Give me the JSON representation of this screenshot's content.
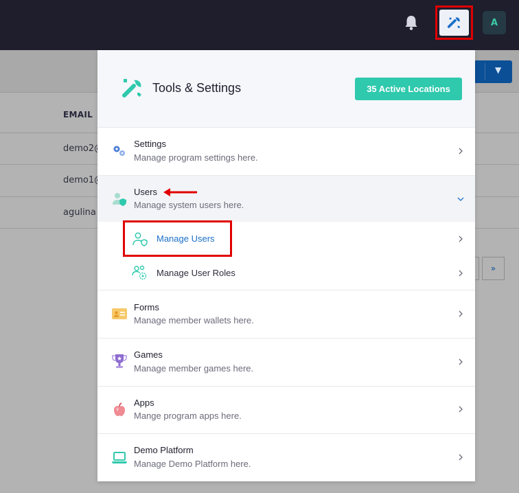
{
  "topbar": {
    "icons": [
      "bell-icon",
      "tools-icon"
    ],
    "avatar_initial": "A"
  },
  "background_page": {
    "column_header": "EMAIL",
    "rows": [
      "demo2@",
      "demo1@",
      "agulina"
    ],
    "pager_next": "»"
  },
  "panel": {
    "title": "Tools & Settings",
    "badge": "35 Active Locations",
    "items": [
      {
        "title": "Settings",
        "desc": "Manage program settings here.",
        "icon": "gears-icon"
      },
      {
        "title": "Users",
        "desc": "Manage system users here.",
        "icon": "user-shield-icon",
        "expanded": true,
        "sub_items": [
          {
            "title": "Manage Users",
            "icon": "user-shield-outline-icon",
            "active": true
          },
          {
            "title": "Manage User Roles",
            "icon": "users-gear-icon"
          }
        ]
      },
      {
        "title": "Forms",
        "desc": "Manage member wallets here.",
        "icon": "id-card-icon"
      },
      {
        "title": "Games",
        "desc": "Manage member games here.",
        "icon": "trophy-icon"
      },
      {
        "title": "Apps",
        "desc": "Mange program apps here.",
        "icon": "apple-icon"
      },
      {
        "title": "Demo Platform",
        "desc": "Manage Demo Platform here.",
        "icon": "laptop-icon"
      }
    ]
  },
  "colors": {
    "topbar": "#1e1e2d",
    "accent_teal": "#2fc9ad",
    "link_blue": "#1a6fc9",
    "annotation_red": "#e00000"
  }
}
